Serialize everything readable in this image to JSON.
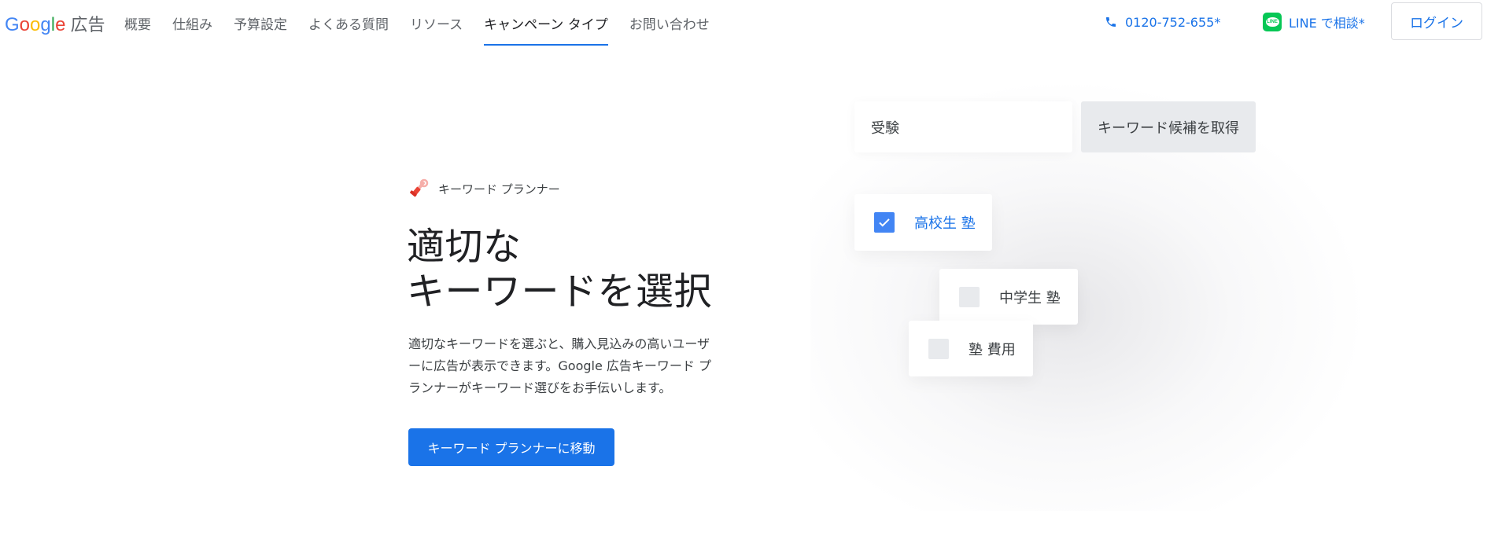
{
  "header": {
    "logo_letters": [
      "G",
      "o",
      "o",
      "g",
      "l",
      "e"
    ],
    "logo_suffix": "広告",
    "nav": [
      {
        "label": "概要"
      },
      {
        "label": "仕組み"
      },
      {
        "label": "予算設定"
      },
      {
        "label": "よくある質問"
      },
      {
        "label": "リソース"
      },
      {
        "label": "キャンペーン タイプ",
        "active": true
      },
      {
        "label": "お問い合わせ"
      }
    ],
    "phone": "0120-752-655*",
    "line": "LINE で相談*",
    "line_icon_text": "LINE",
    "login": "ログイン"
  },
  "main": {
    "eyebrow": "キーワード プランナー",
    "headline_line1": "適切な",
    "headline_line2": "キーワードを選択",
    "description": "適切なキーワードを選ぶと、購入見込みの高いユーザーに広告が表示できます。Google 広告キーワード プランナーがキーワード選びをお手伝いします。",
    "cta": "キーワード プランナーに移動"
  },
  "illustration": {
    "search_value": "受験",
    "fetch_button": "キーワード候補を取得",
    "keywords": [
      {
        "label": "高校生 塾",
        "checked": true
      },
      {
        "label": "中学生 塾",
        "checked": false
      },
      {
        "label": "塾 費用",
        "checked": false
      }
    ]
  },
  "colors": {
    "accent": "#1a73e8",
    "line_green": "#06C755",
    "checkbox_checked": "#4285F4",
    "checkbox_unchecked": "#e8eaed"
  },
  "icons": [
    "phone-icon",
    "line-icon",
    "wrench-screwdriver-icon",
    "checkmark-icon"
  ]
}
